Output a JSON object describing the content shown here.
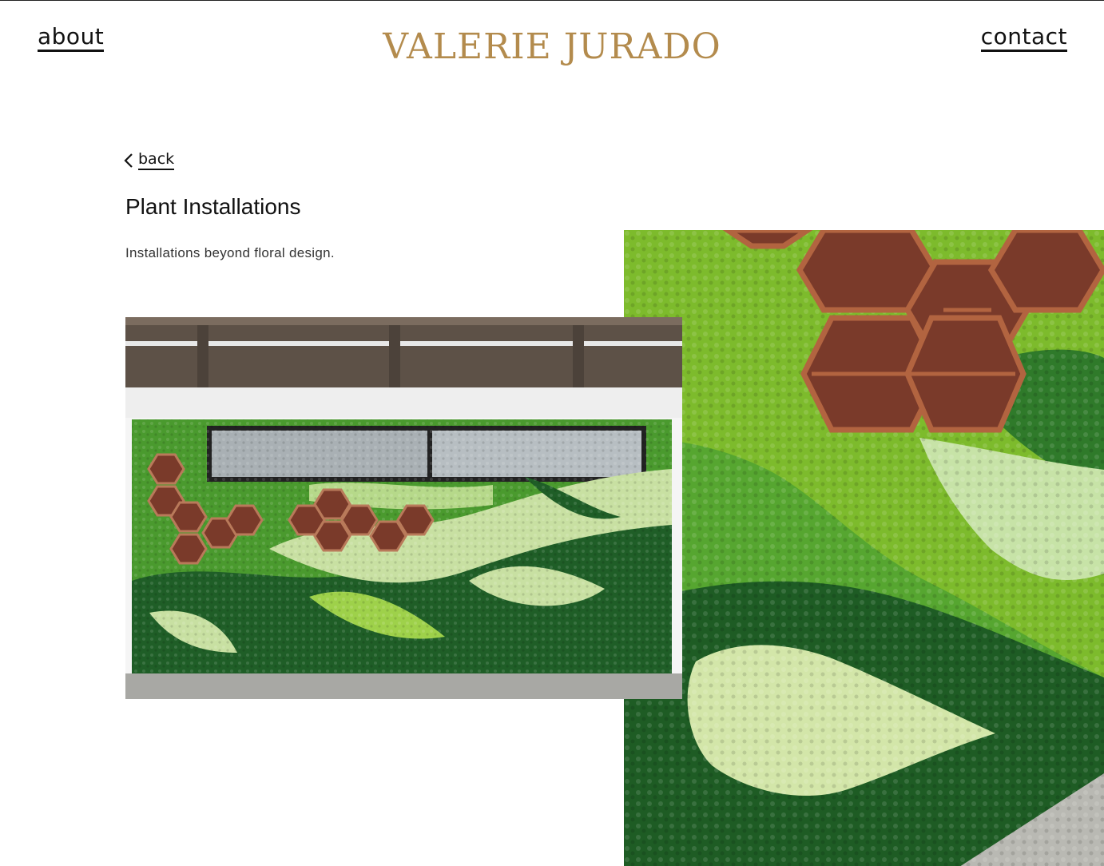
{
  "header": {
    "brand": "VALERIE JURADO",
    "about_label": "about",
    "contact_label": "contact"
  },
  "nav": {
    "back_label": "back"
  },
  "project": {
    "title": "Plant Installations",
    "description": "Installations beyond floral design."
  },
  "colors": {
    "brand_gold": "#b38b4d",
    "text": "#111111",
    "moss_dark": "#1f5e2a",
    "moss_mid": "#4e9a2e",
    "moss_light": "#9fd14a",
    "moss_pale": "#cfe3a6",
    "wood": "#8b4a34"
  },
  "gallery": {
    "images": [
      {
        "name": "moss-wall-wide-photo"
      },
      {
        "name": "moss-wall-closeup-photo"
      }
    ]
  }
}
